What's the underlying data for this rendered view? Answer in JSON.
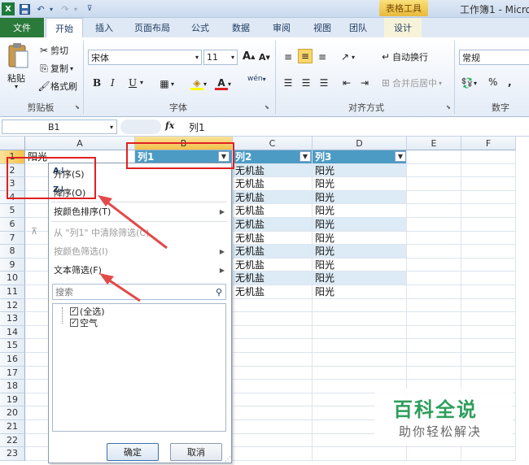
{
  "titlebar": {
    "app_icon": "X",
    "context_tab_title": "表格工具",
    "window_title": "工作簿1 - Micro"
  },
  "tabs": [
    {
      "label": "文件"
    },
    {
      "label": "开始"
    },
    {
      "label": "插入"
    },
    {
      "label": "页面布局"
    },
    {
      "label": "公式"
    },
    {
      "label": "数据"
    },
    {
      "label": "审阅"
    },
    {
      "label": "视图"
    },
    {
      "label": "团队"
    },
    {
      "label": "设计"
    }
  ],
  "ribbon": {
    "clipboard": {
      "paste": "粘贴",
      "cut": "剪切",
      "copy": "复制",
      "format_painter": "格式刷",
      "group_label": "剪贴板"
    },
    "font": {
      "name": "宋体",
      "size": "11",
      "grow": "A",
      "shrink": "A",
      "bold": "B",
      "italic": "I",
      "underline": "U",
      "phonetic": "wén",
      "group_label": "字体"
    },
    "alignment": {
      "wrap_text": "自动换行",
      "merge_center": "合并后居中",
      "group_label": "对齐方式"
    },
    "number": {
      "format": "常规",
      "percent": "%",
      "comma": ",",
      "group_label": "数字"
    }
  },
  "formula_bar": {
    "name_box": "B1",
    "fx": "fx",
    "value": "列1"
  },
  "grid": {
    "columns": [
      "A",
      "B",
      "C",
      "D",
      "E",
      "F"
    ],
    "rows": [
      "1",
      "2",
      "3",
      "4",
      "5",
      "6",
      "7",
      "8",
      "9",
      "10",
      "11",
      "12",
      "13",
      "14",
      "15",
      "16",
      "17",
      "18",
      "19",
      "20",
      "21",
      "22",
      "23"
    ],
    "a1": "阳光",
    "headers": {
      "b": "列1",
      "c": "列2",
      "d": "列3"
    },
    "col_c": [
      "无机盐",
      "无机盐",
      "无机盐",
      "无机盐",
      "无机盐",
      "无机盐",
      "无机盐",
      "无机盐",
      "无机盐",
      "无机盐"
    ],
    "col_d": [
      "阳光",
      "阳光",
      "阳光",
      "阳光",
      "阳光",
      "阳光",
      "阳光",
      "阳光",
      "阳光",
      "阳光"
    ]
  },
  "filter_menu": {
    "sort_asc": "升序(S)",
    "sort_desc": "降序(O)",
    "sort_by_color": "按颜色排序(T)",
    "clear_filter": "从 \"列1\" 中清除筛选(C)",
    "filter_by_color": "按颜色筛选(I)",
    "text_filter": "文本筛选(F)",
    "search_placeholder": "搜索",
    "select_all": "(全选)",
    "value_item": "空气",
    "ok": "确定",
    "cancel": "取消"
  },
  "watermark": {
    "title": "百科全说",
    "subtitle": "助你轻松解决"
  },
  "colors": {
    "file_tab": "#2a7a3a",
    "table_header": "#4b9bc4",
    "table_band": "#dcebf5",
    "highlight_red": "#e02020",
    "watermark_green": "#2e9e5b"
  }
}
